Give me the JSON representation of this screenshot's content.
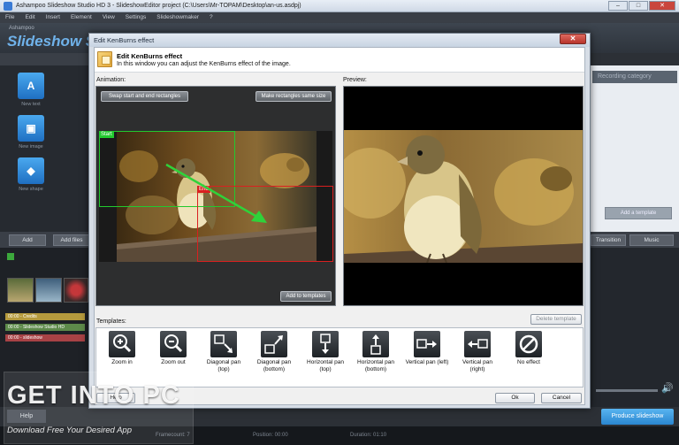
{
  "background_app": {
    "title": "Ashampoo Slideshow Studio HD 3 - SlideshowEditor project (C:\\Users\\Mr-TOPAM\\Desktop\\an-us.asdpj)",
    "menu": [
      "File",
      "Edit",
      "Insert",
      "Element",
      "View",
      "Settings",
      "Slideshowmaker",
      "?"
    ],
    "brand_small": "Ashampoo",
    "brand_name": "Slideshow St",
    "side_buttons": [
      "New text",
      "New image",
      "New shape"
    ],
    "right_header": "Recording category",
    "right_control": "Add a template",
    "timeline_buttons": [
      "Add",
      "Add files"
    ],
    "right_timeline_buttons": [
      "Transition",
      "Music"
    ],
    "tracks": [
      "00:00 - Credits",
      "00:00 - Slideshow Studio HD",
      "00:00 - slideshow"
    ],
    "help_label": "Help",
    "produce_label": "Produce slideshow",
    "status": [
      "Framecount: 7",
      "Position: 00:00",
      "Duration: 01:10"
    ]
  },
  "watermark": {
    "logo": "GET INTO PC",
    "tagline": "Download Free Your Desired App"
  },
  "dialog": {
    "title": "Edit KenBurns effect",
    "header_title": "Edit KenBurns effect",
    "header_desc": "In this window you can adjust the KenBurns effect of the image.",
    "animation_label": "Animation:",
    "preview_label": "Preview:",
    "swap_label": "Swap start and end rectangles",
    "same_size_label": "Make rectangles same size",
    "start_tag": "Start",
    "end_tag": "End",
    "add_to_templates_label": "Add to templates",
    "templates_label": "Templates:",
    "delete_template_label": "Delete template",
    "templates": [
      {
        "label": "Zoom in",
        "icon": "zoom-in-icon"
      },
      {
        "label": "Zoom out",
        "icon": "zoom-out-icon"
      },
      {
        "label": "Diagonal pan (top)",
        "icon": "diagonal-pan-top-icon"
      },
      {
        "label": "Diagonal pan (bottom)",
        "icon": "diagonal-pan-bottom-icon"
      },
      {
        "label": "Horizontal pan (top)",
        "icon": "horizontal-pan-top-icon"
      },
      {
        "label": "Horizontal pan (bottom)",
        "icon": "horizontal-pan-bottom-icon"
      },
      {
        "label": "Vertical pan (left)",
        "icon": "vertical-pan-left-icon"
      },
      {
        "label": "Vertical pan (right)",
        "icon": "vertical-pan-right-icon"
      },
      {
        "label": "No effect",
        "icon": "no-effect-icon"
      }
    ],
    "help_label": "Help",
    "ok_label": "Ok",
    "cancel_label": "Cancel"
  },
  "colors": {
    "start_rect": "#22c92e",
    "end_rect": "#d92020",
    "arrow": "#2fd23a",
    "accent": "#3a8fdc"
  }
}
